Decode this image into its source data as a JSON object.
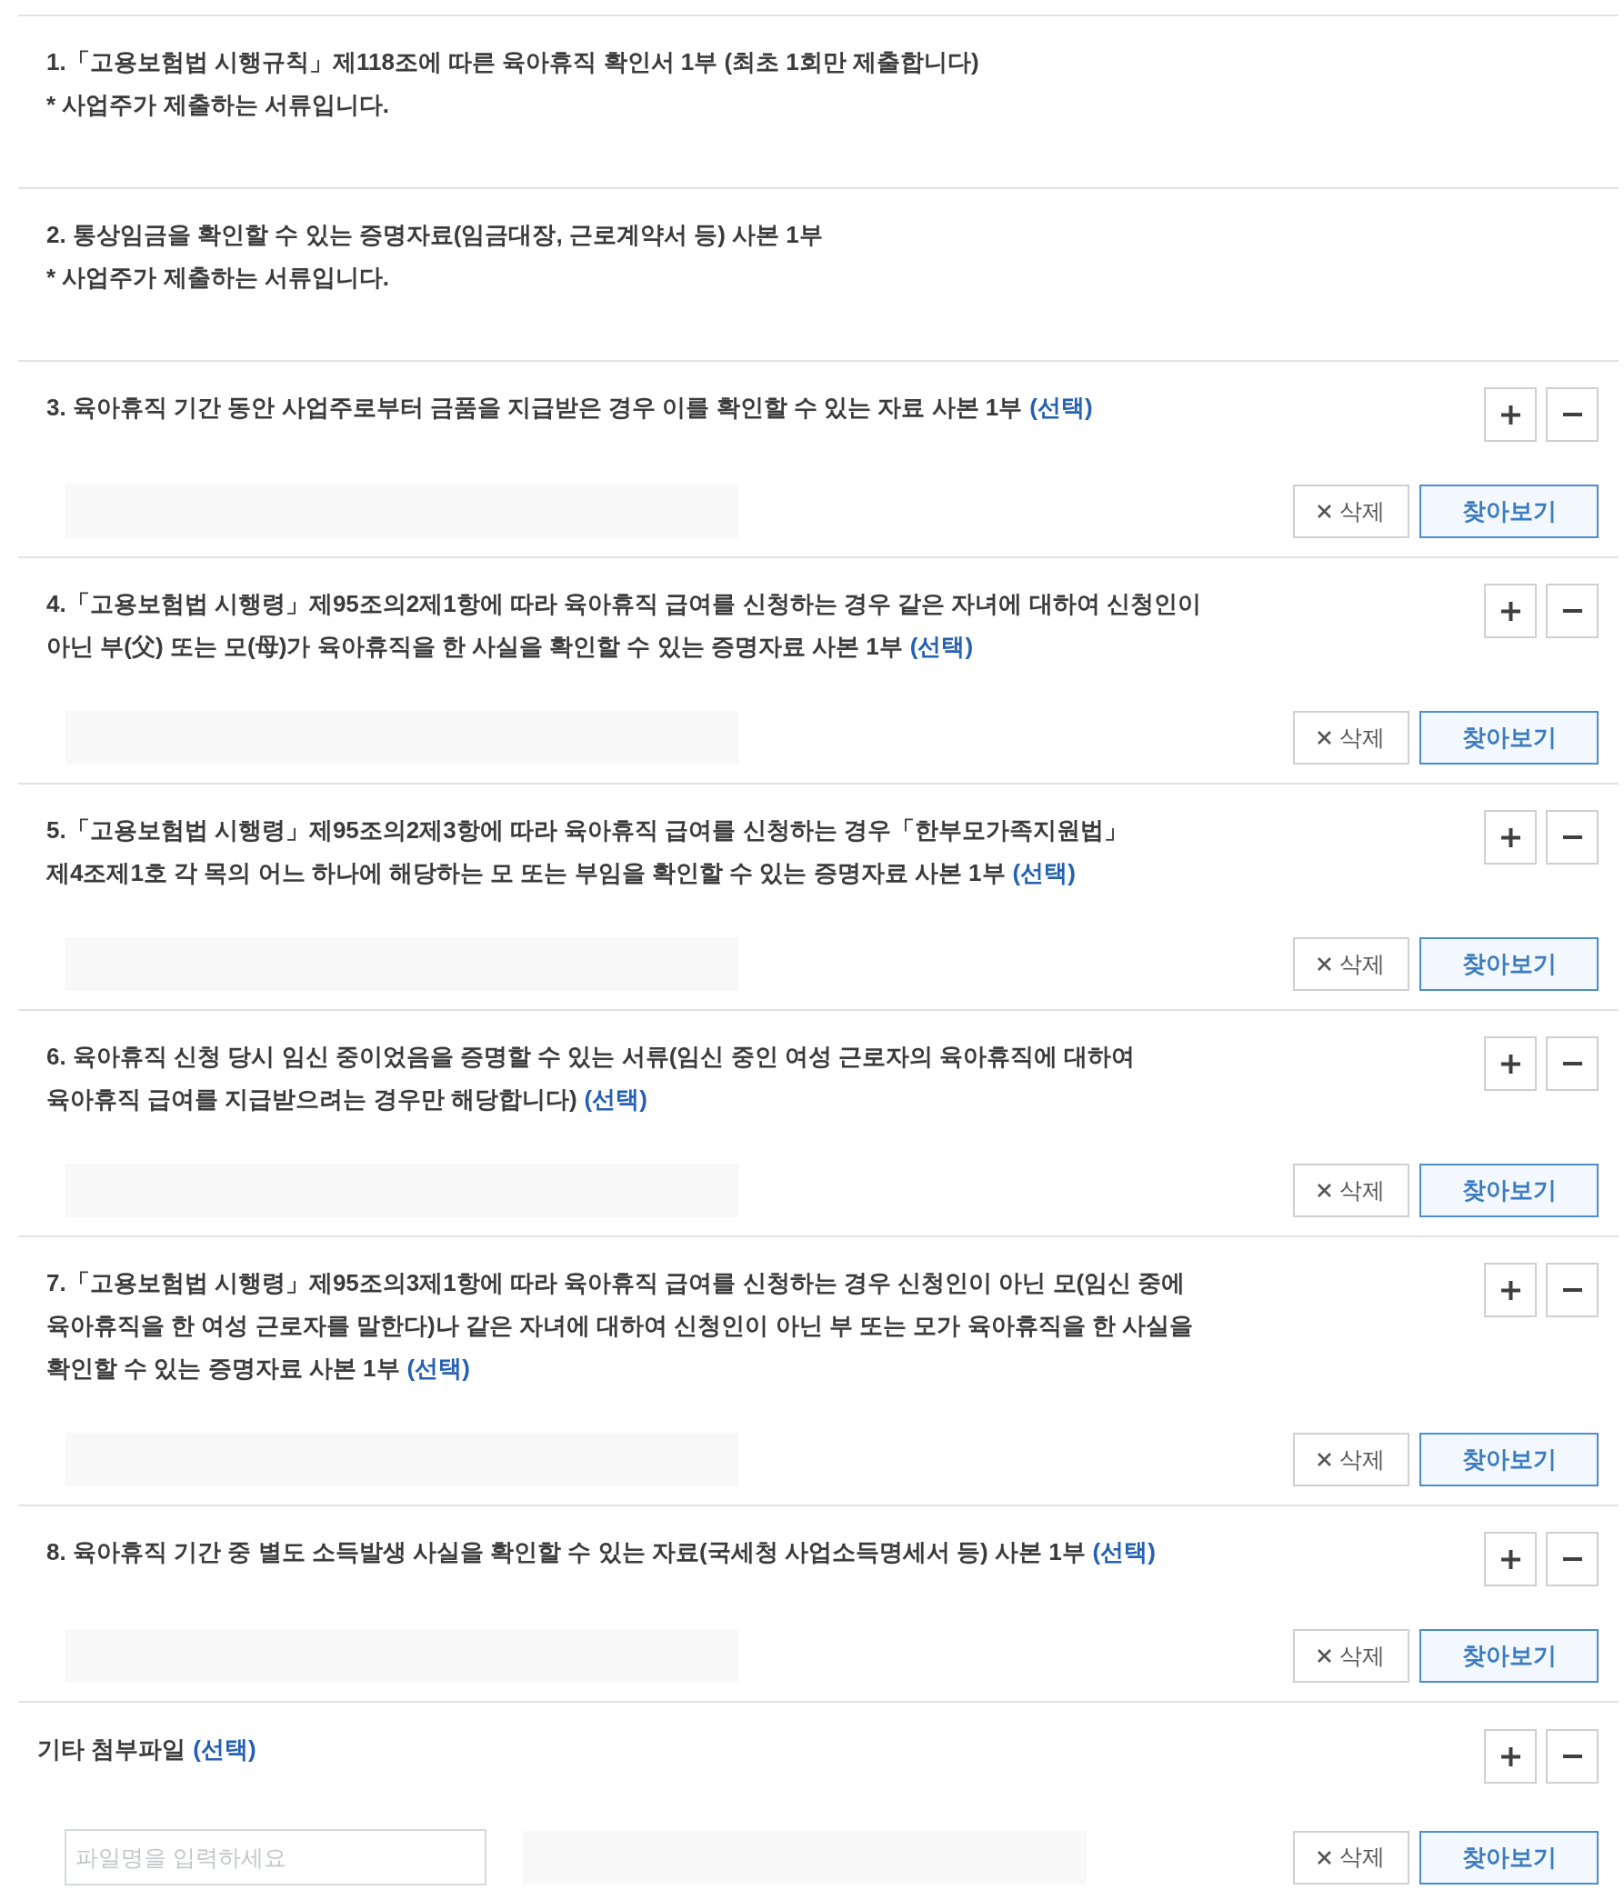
{
  "sections": [
    {
      "kind": "notice",
      "lines": [
        "1.「고용보험법 시행규칙」제118조에 따른 육아휴직 확인서 1부 (최초 1회만 제출합니다)",
        "* 사업주가 제출하는 서류입니다."
      ]
    },
    {
      "kind": "notice",
      "lines": [
        "2. 통상임금을 확인할 수 있는 증명자료(임금대장, 근로계약서 등) 사본 1부",
        "* 사업주가 제출하는 서류입니다."
      ]
    },
    {
      "kind": "attachment",
      "lines": [
        "3. 육아휴직 기간 동안 사업주로부터 금품을 지급받은 경우 이를 확인할 수 있는 자료 사본 1부"
      ],
      "tag": "(선택)",
      "delete_label": "삭제",
      "browse_label": "찾아보기"
    },
    {
      "kind": "attachment",
      "lines": [
        "4.「고용보험법 시행령」제95조의2제1항에 따라 육아휴직 급여를 신청하는 경우 같은 자녀에 대하여 신청인이",
        "아닌 부(父) 또는 모(母)가 육아휴직을 한 사실을 확인할 수 있는 증명자료 사본 1부"
      ],
      "tag": "(선택)",
      "delete_label": "삭제",
      "browse_label": "찾아보기"
    },
    {
      "kind": "attachment",
      "lines": [
        "5.「고용보험법 시행령」제95조의2제3항에 따라 육아휴직 급여를 신청하는 경우「한부모가족지원법」",
        "제4조제1호 각 목의 어느 하나에 해당하는 모 또는 부임을 확인할 수 있는 증명자료 사본 1부"
      ],
      "tag": "(선택)",
      "delete_label": "삭제",
      "browse_label": "찾아보기"
    },
    {
      "kind": "attachment",
      "lines": [
        "6. 육아휴직 신청 당시 임신 중이었음을 증명할 수 있는 서류(임신 중인 여성 근로자의 육아휴직에 대하여",
        "육아휴직 급여를 지급받으려는 경우만 해당합니다)"
      ],
      "tag": "(선택)",
      "delete_label": "삭제",
      "browse_label": "찾아보기"
    },
    {
      "kind": "attachment",
      "lines": [
        "7.「고용보험법 시행령」제95조의3제1항에 따라 육아휴직 급여를 신청하는 경우 신청인이 아닌 모(임신 중에",
        "육아휴직을 한 여성 근로자를 말한다)나 같은 자녀에 대하여 신청인이 아닌 부 또는 모가 육아휴직을 한 사실을",
        "확인할 수 있는 증명자료 사본 1부"
      ],
      "tag": "(선택)",
      "delete_label": "삭제",
      "browse_label": "찾아보기"
    },
    {
      "kind": "attachment",
      "lines": [
        "8. 육아휴직 기간 중 별도 소득발생 사실을 확인할 수 있는 자료(국세청 사업소득명세서 등) 사본 1부"
      ],
      "tag": "(선택)",
      "delete_label": "삭제",
      "browse_label": "찾아보기"
    },
    {
      "kind": "other",
      "lines": [
        "기타 첨부파일"
      ],
      "tag": "(선택)",
      "placeholder": "파일명을 입력하세요",
      "delete_label": "삭제",
      "browse_label": "찾아보기"
    }
  ]
}
